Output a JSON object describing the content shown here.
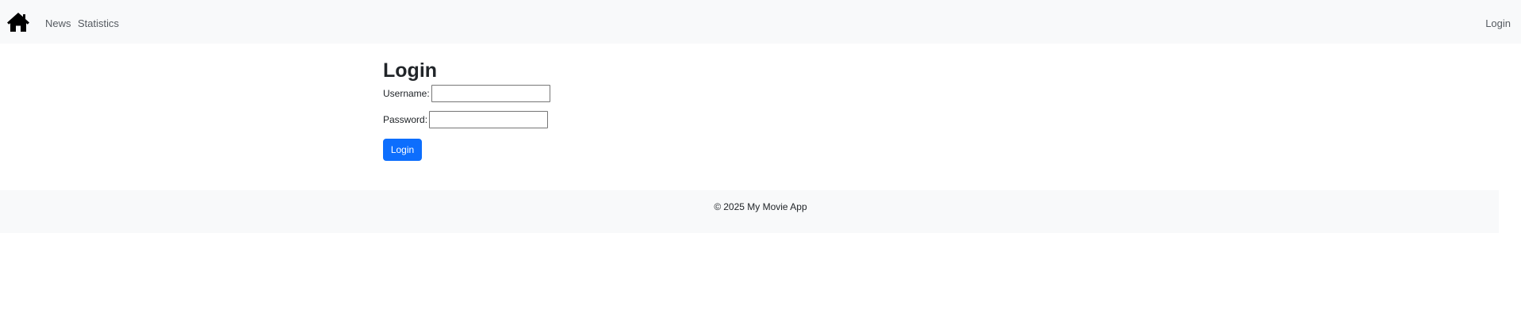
{
  "navbar": {
    "home_icon": "house-icon",
    "links": {
      "news": "News",
      "statistics": "Statistics",
      "login": "Login"
    }
  },
  "main": {
    "title": "Login",
    "username_label": "Username:",
    "username_value": "",
    "password_label": "Password:",
    "password_value": "",
    "submit_label": "Login"
  },
  "footer": {
    "copyright_symbol": "©",
    "text": "2025 My Movie App"
  },
  "colors": {
    "navbar_bg": "#f8f9fa",
    "primary_button": "#0d6efd",
    "text": "#212529"
  }
}
